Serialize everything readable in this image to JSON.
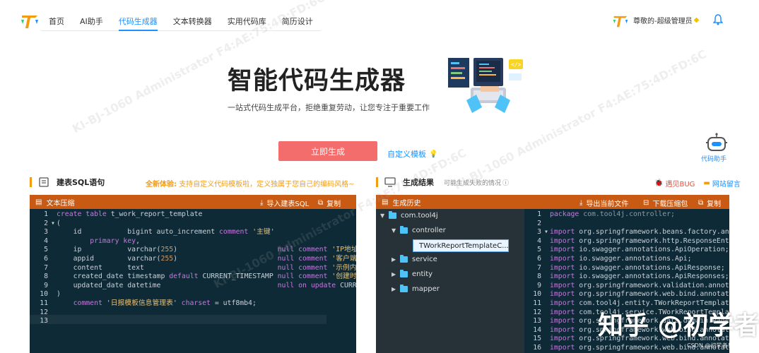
{
  "nav": {
    "items": [
      {
        "label": "首页",
        "active": false
      },
      {
        "label": "AI助手",
        "active": false
      },
      {
        "label": "代码生成器",
        "active": true
      },
      {
        "label": "文本转换器",
        "active": false
      },
      {
        "label": "实用代码库",
        "active": false
      },
      {
        "label": "简历设计",
        "active": false
      }
    ],
    "user": {
      "name": "尊敬的-超级管理员",
      "badge_icon": "diamond-icon"
    },
    "notification_icon": "bell-icon"
  },
  "hero": {
    "title": "智能代码生成器",
    "subtitle": "一站式代码生成平台，拒绝重复劳动，让您专注于重要工作",
    "generate_button": "立即生成",
    "custom_template_link": "自定义模板",
    "assistant_label": "代码助手"
  },
  "left_section": {
    "title": "建表SQL语句",
    "new_exp_highlight": "全新体验:",
    "new_exp_desc": "支持自定义代码模板啦，定义独属于您自己的编码风格~",
    "panel_title": "文本压缩",
    "import_label": "导入建表SQL",
    "copy_label": "复制",
    "line_numbers": [
      "1",
      "2",
      "3",
      "4",
      "5",
      "6",
      "7",
      "8",
      "9",
      "10",
      "11",
      "12",
      "13"
    ],
    "code_lines": [
      "create table t_work_report_template",
      "(",
      "    id           bigint auto_increment comment '主键'",
      "        primary key,",
      "    ip           varchar(255)                        null comment 'IP地址'",
      "    appid        varchar(255)                        null comment '客户端'",
      "    content      text                                null comment '示例内'",
      "    created_date timestamp default CURRENT_TIMESTAMP null comment '创建时'",
      "    updated_date datetime                            null on update CURRENT",
      ")",
      "    comment '日报模板信息管理表' charset = utf8mb4;",
      "",
      ""
    ]
  },
  "right_section": {
    "title": "生成结果",
    "hint": "可能生成失败的情况",
    "bug_link": "遇见BUG",
    "message_link": "网站留言",
    "panel_title": "生成历史",
    "export_label": "导出当前文件",
    "download_label": "下载压缩包",
    "copy_label": "复制",
    "tree": {
      "root": "com.tool4j",
      "children": [
        "controller",
        "service",
        "entity",
        "mapper"
      ],
      "selected_file": "TWorkReportTemplateC..."
    },
    "line_numbers": [
      "1",
      "2",
      "3",
      "4",
      "5",
      "6",
      "7",
      "8",
      "9",
      "10",
      "11",
      "12",
      "13",
      "14",
      "15",
      "16"
    ],
    "code_lines": [
      "package com.tool4j.controller;",
      "",
      "import org.springframework.beans.factory.ann",
      "import org.springframework.http.ResponseEnti",
      "import io.swagger.annotations.ApiOperation;",
      "import io.swagger.annotations.Api;",
      "import io.swagger.annotations.ApiResponse;",
      "import io.swagger.annotations.ApiResponses;",
      "import org.springframework.validation.annota",
      "import org.springframework.web.bind.annotati",
      "import com.tool4j.entity.TWorkReportTemplate",
      "import com.tool4j.service.TWorkReportTemplat",
      "import org.springframework.data.domain.Page;",
      "import org.springframework.web.bind.annotati",
      "import org.springframework.web.bind.annotati",
      "import org.springframework.web.bind.annotati"
    ]
  },
  "watermark": {
    "text": "KI-BJ-1060  Administrator  F4:AE:75:4D:FD:6C",
    "zhihu": "知乎 @初学者",
    "zhihu_small": "CSDN @初学者！"
  },
  "colors": {
    "accent": "#1e90ff",
    "generate_button": "#f46d6d",
    "panel_bar": "#c85a14",
    "editor_bg": "#0d2a36",
    "tree_bg": "#263238",
    "highlight": "#f39c12"
  }
}
